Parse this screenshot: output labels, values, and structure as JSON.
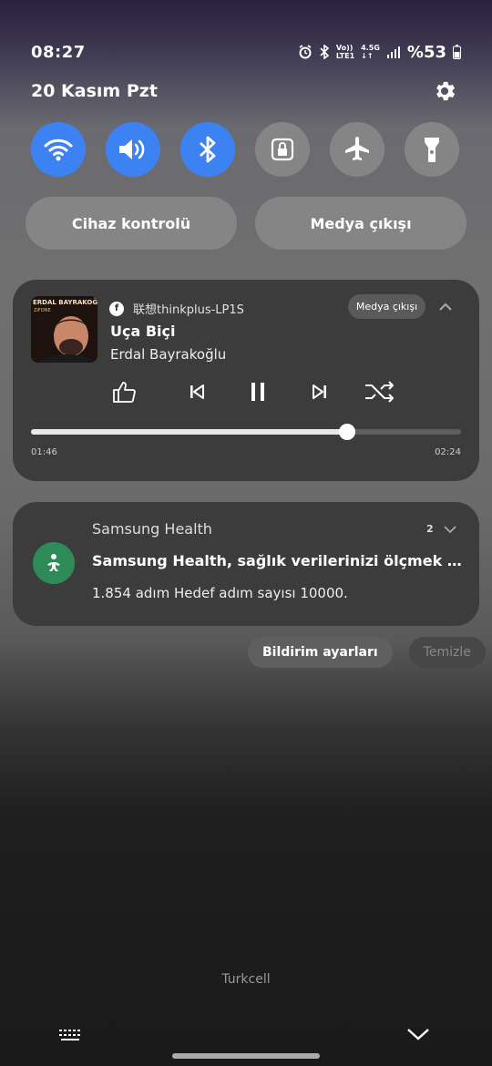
{
  "status_bar": {
    "time": "08:27",
    "alarm_icon": "alarm-icon",
    "bluetooth_icon": "bluetooth-icon",
    "volte_top": "Vo))",
    "volte_bottom": "LTE1",
    "network_top": "4.5G",
    "network_bottom": "↓↑",
    "signal_icon": "signal-icon",
    "battery": "%53"
  },
  "header": {
    "date": "20 Kasım Pzt",
    "settings_icon": "gear-icon"
  },
  "quick_toggles": [
    {
      "name": "wifi",
      "icon": "wifi-icon",
      "state": "on"
    },
    {
      "name": "sound",
      "icon": "speaker-icon",
      "state": "on"
    },
    {
      "name": "bluetooth",
      "icon": "bluetooth-icon",
      "state": "on"
    },
    {
      "name": "rotation-lock",
      "icon": "lock-icon",
      "state": "off"
    },
    {
      "name": "airplane",
      "icon": "airplane-icon",
      "state": "off"
    },
    {
      "name": "flashlight",
      "icon": "flashlight-icon",
      "state": "off"
    }
  ],
  "pills": {
    "device_control": "Cihaz kontrolü",
    "media_output": "Medya çıkışı"
  },
  "media": {
    "album_title": "ERDAL BAYRAKOĞLU",
    "album_sub": "ZIFONE",
    "device": "联想thinkplus-LP1S",
    "output_chip": "Medya çıkışı",
    "song": "Uça Biçi",
    "artist": "Erdal Bayrakoğlu",
    "elapsed": "01:46",
    "duration": "02:24",
    "progress": 0.736
  },
  "notification": {
    "app": "Samsung Health",
    "count": "2",
    "title": "Samsung Health, sağlık verilerinizi ölçmek için...",
    "body": "1.854 adım Hedef adım sayısı 10000."
  },
  "actions": {
    "settings": "Bildirim ayarları",
    "clear": "Temizle"
  },
  "carrier": "Turkcell",
  "colors": {
    "toggle_on": "#3d82f3",
    "toggle_off": "#858585",
    "health_green": "#2e8b57"
  }
}
